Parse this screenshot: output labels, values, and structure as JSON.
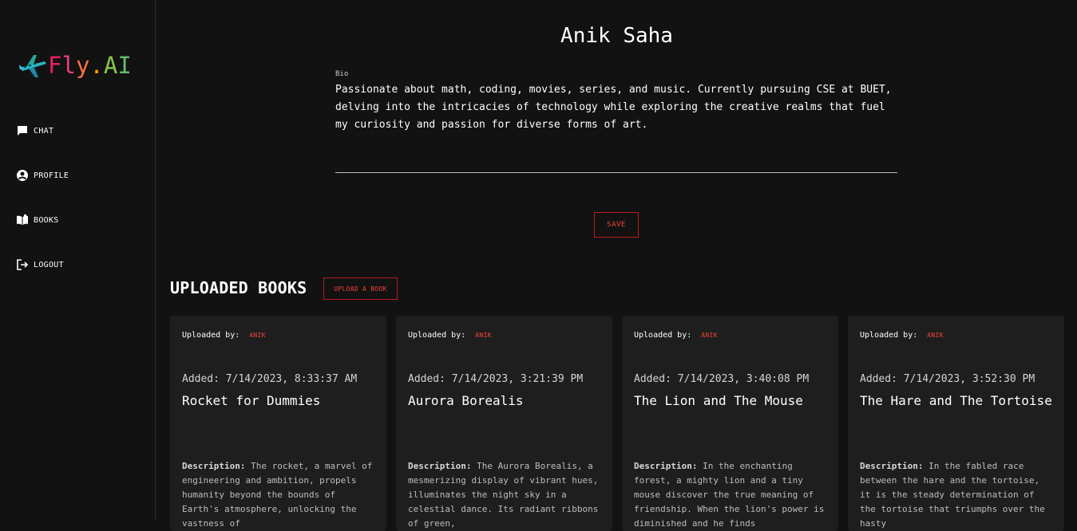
{
  "sidebar": {
    "logo_text": "Fly.AI",
    "logo_letters": [
      {
        "ch": "F",
        "color": "#e91e63"
      },
      {
        "ch": "l",
        "color": "#ec407a"
      },
      {
        "ch": "y",
        "color": "#ff7043"
      },
      {
        "ch": ".",
        "color": "#ff9800"
      },
      {
        "ch": "A",
        "color": "#8bc34a"
      },
      {
        "ch": "I",
        "color": "#66bb6a"
      }
    ],
    "logo_icon": "airplane-icon",
    "items": [
      {
        "label": "CHAT",
        "icon": "chat-icon"
      },
      {
        "label": "PROFILE",
        "icon": "account-circle-icon"
      },
      {
        "label": "BOOKS",
        "icon": "book-icon"
      },
      {
        "label": "LOGOUT",
        "icon": "logout-icon"
      }
    ]
  },
  "profile": {
    "name": "Anik Saha",
    "bio_label": "Bio",
    "bio_text": "Passionate about math, coding, movies, series, and music. Currently pursuing CSE at BUET, delving into the intricacies of technology while exploring the creative realms that fuel my curiosity and passion for diverse forms of art.",
    "save_label": "SAVE"
  },
  "books": {
    "section_title": "UPLOADED BOOKS",
    "upload_label": "UPLOAD A BOOK",
    "uploaded_by_label": "Uploaded by:",
    "description_label": "Description:",
    "items": [
      {
        "uploader": "ANIK",
        "added": "Added: 7/14/2023, 8:33:37 AM",
        "title": "Rocket for Dummies",
        "description": "The rocket, a marvel of engineering and ambition, propels humanity beyond the bounds of Earth's atmosphere, unlocking the vastness of"
      },
      {
        "uploader": "ANIK",
        "added": "Added: 7/14/2023, 3:21:39 PM",
        "title": "Aurora Borealis",
        "description": "The Aurora Borealis, a mesmerizing display of vibrant hues, illuminates the night sky in a celestial dance. Its radiant ribbons of green,"
      },
      {
        "uploader": "ANIK",
        "added": "Added: 7/14/2023, 3:40:08 PM",
        "title": "The Lion and The Mouse",
        "description": "In the enchanting forest, a mighty lion and a tiny mouse discover the true meaning of friendship. When the lion's power is diminished and he finds"
      },
      {
        "uploader": "ANIK",
        "added": "Added: 7/14/2023, 3:52:30 PM",
        "title": "The Hare and The Tortoise",
        "description": "In the fabled race between the hare and the tortoise, it is the steady determination of the tortoise that triumphs over the hasty"
      }
    ]
  },
  "colors": {
    "background": "#121212",
    "card": "#1e1e1e",
    "accent_red": "#f44336"
  }
}
